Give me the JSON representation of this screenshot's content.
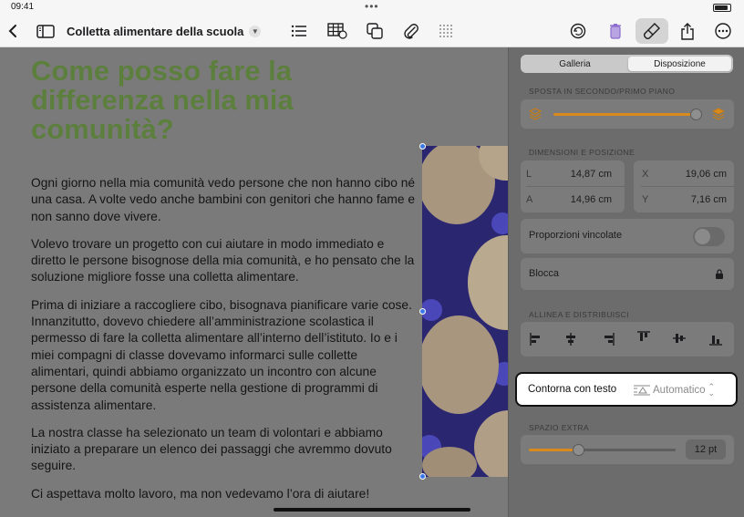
{
  "status_bar": {
    "time": "09:41",
    "dots": "•••"
  },
  "toolbar": {
    "title": "Colletta alimentare della scuola",
    "icons": [
      "back-chevron-icon",
      "sidebar-icon",
      "title-menu-chevron-icon",
      "list-icon",
      "table-icon",
      "copy-shape-icon",
      "paperclip-icon",
      "grid-icon",
      "undo-icon",
      "trash-icon",
      "paintbrush-icon",
      "share-icon",
      "more-icon"
    ]
  },
  "document": {
    "heading": "Come posso fare la differenza nella mia comunità?",
    "paragraphs": [
      "Ogni giorno nella mia comunità vedo persone che non hanno cibo né una casa. A volte vedo anche bambini con genitori che hanno fame e non sanno dove vivere.",
      "Volevo trovare un progetto con cui aiutare in modo immediato e diretto le persone bisognose della mia comunità, e ho pensato che la soluzione migliore fosse una colletta alimentare.",
      "Prima di iniziare a raccogliere cibo, bisognava pianificare varie cose. Innanzitutto, dovevo chiedere all’amministrazione scolastica il permesso di fare la colletta alimentare all’interno dell’istituto. Io e i miei compagni di classe dovevamo informarci sulle collette alimentari, quindi abbiamo organizzato un incontro con alcune persone della comunità esperte nella gestione di programmi di assistenza alimentare.",
      "La nostra classe ha selezionato un team di volontari e abbiamo iniziato a preparare un elenco dei passaggi che avremmo dovuto seguire.",
      "Ci aspettava molto lavoro, ma non vedevamo l’ora di aiutare!"
    ]
  },
  "panel": {
    "tabs": [
      "Galleria",
      "Disposizione"
    ],
    "selected_tab": "Disposizione",
    "move_section": "SPOSTA IN SECONDO/PRIMO PIANO",
    "move_level": 0.9,
    "dim_section": "DIMENSIONI E POSIZIONE",
    "fields": {
      "L": {
        "label": "L",
        "value": "14,87 cm"
      },
      "A": {
        "label": "A",
        "value": "14,96 cm"
      },
      "X": {
        "label": "X",
        "value": "19,06 cm"
      },
      "Y": {
        "label": "Y",
        "value": "7,16 cm"
      }
    },
    "constrain_label": "Proporzioni vincolate",
    "constrain_on": false,
    "lock_label": "Blocca",
    "align_section": "ALLINEA E DISTRIBUISCI",
    "wrap_label": "Contorna con testo",
    "wrap_value": "Automatico",
    "spacing_section": "SPAZIO EXTRA",
    "spacing_value": "12 pt",
    "spacing_level": 0.33
  },
  "colors": {
    "heading": "#5d7f3e",
    "slider": "#d88a1c",
    "selection": "#3a78e7"
  }
}
